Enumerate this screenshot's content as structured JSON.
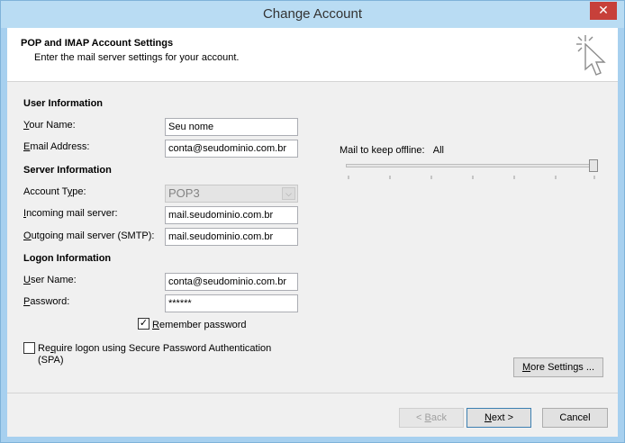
{
  "window": {
    "title": "Change Account",
    "close_glyph": "✕"
  },
  "header": {
    "title": "POP and IMAP Account Settings",
    "subtitle": "Enter the mail server settings for your account.",
    "icon": "cursor-click-icon"
  },
  "user_info": {
    "heading": "User Information",
    "name_label_key": "Y",
    "name_label_rest": "our Name:",
    "name_value": "Seu nome",
    "email_label_key": "E",
    "email_label_rest": "mail Address:",
    "email_value": "conta@seudominio.com.br"
  },
  "server_info": {
    "heading": "Server Information",
    "account_type_label_pre": "Account T",
    "account_type_label_key": "y",
    "account_type_label_rest": "pe:",
    "account_type_value": "POP3",
    "incoming_label_key": "I",
    "incoming_label_rest": "ncoming mail server:",
    "incoming_value": "mail.seudominio.com.br",
    "outgoing_label_key": "O",
    "outgoing_label_rest": "utgoing mail server (SMTP):",
    "outgoing_value": "mail.seudominio.com.br"
  },
  "logon_info": {
    "heading": "Logon Information",
    "username_label_key": "U",
    "username_label_rest": "ser Name:",
    "username_value": "conta@seudominio.com.br",
    "password_label_key": "P",
    "password_label_rest": "assword:",
    "password_value": "******",
    "remember_key": "R",
    "remember_rest": "emember password",
    "remember_checked": true,
    "spa_pre": "Re",
    "spa_key": "q",
    "spa_rest": "uire logon using Secure Password Authentication",
    "spa_line2": "(SPA)",
    "spa_checked": false
  },
  "offline": {
    "label": "Mail to keep offline:",
    "value": "All",
    "slider_fraction": 1.0
  },
  "buttons": {
    "more_settings_pre": "",
    "more_settings_key": "M",
    "more_settings_rest": "ore Settings ...",
    "back_pre": "< ",
    "back_key": "B",
    "back_rest": "ack",
    "next_pre": "",
    "next_key": "N",
    "next_rest": "ext >",
    "cancel": "Cancel"
  }
}
